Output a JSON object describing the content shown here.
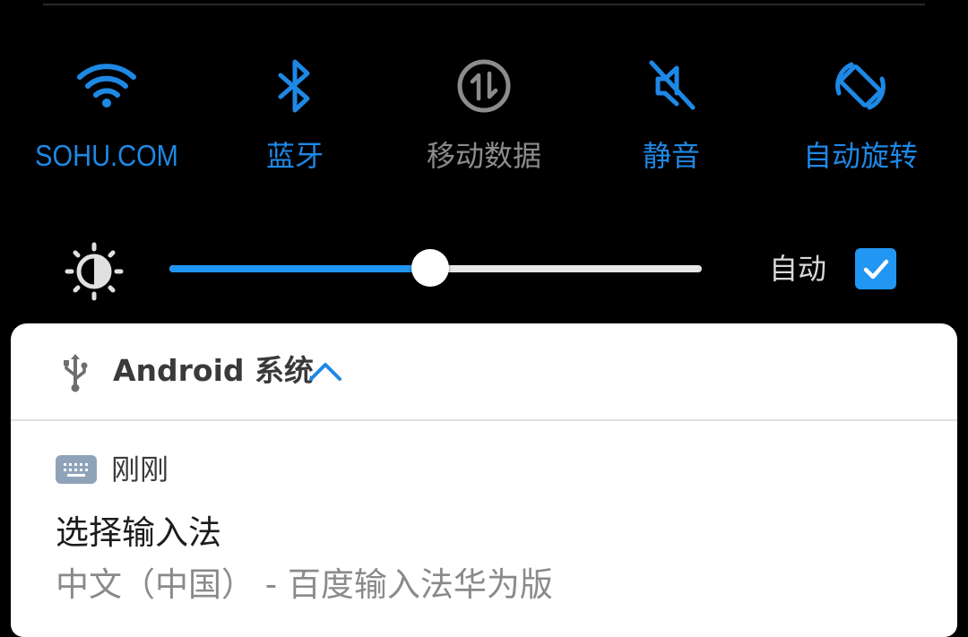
{
  "quick_settings": {
    "tiles": [
      {
        "label": "SOHU.COM",
        "icon": "wifi-icon",
        "state": "on"
      },
      {
        "label": "蓝牙",
        "icon": "bluetooth-icon",
        "state": "on"
      },
      {
        "label": "移动数据",
        "icon": "mobile-data-icon",
        "state": "off"
      },
      {
        "label": "静音",
        "icon": "mute-icon",
        "state": "on"
      },
      {
        "label": "自动旋转",
        "icon": "auto-rotate-icon",
        "state": "on"
      }
    ],
    "brightness": {
      "level_percent": 49,
      "auto_label": "自动",
      "auto_checked": true
    }
  },
  "notification": {
    "app_name": "Android 系统",
    "time": "刚刚",
    "title": "选择输入法",
    "text": "中文（中国） - 百度输入法华为版"
  },
  "colors": {
    "accent": "#1e88e5",
    "inactive": "#8c8c8c",
    "slider_fill": "#2196f3"
  }
}
